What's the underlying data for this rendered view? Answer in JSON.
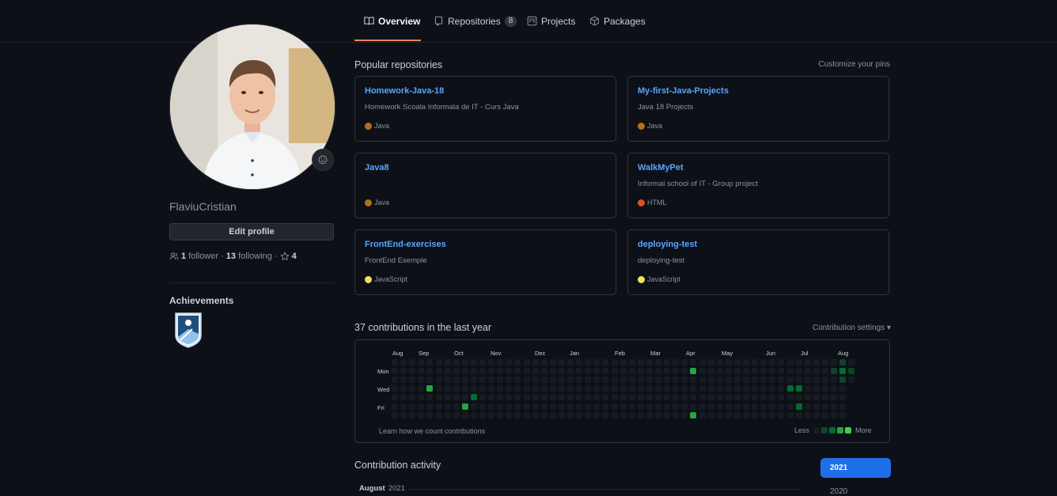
{
  "nav": {
    "tabs": [
      {
        "label": "Overview",
        "icon": "book-icon",
        "active": true
      },
      {
        "label": "Repositories",
        "icon": "repo-icon",
        "count": "8"
      },
      {
        "label": "Projects",
        "icon": "project-icon"
      },
      {
        "label": "Packages",
        "icon": "package-icon"
      }
    ]
  },
  "profile": {
    "username": "FlaviuCristian",
    "edit_label": "Edit profile",
    "followers_count": "1",
    "followers_label": "follower",
    "following_count": "13",
    "following_label": "following",
    "stars_count": "4",
    "achievements_title": "Achievements"
  },
  "pinned": {
    "title": "Popular repositories",
    "customize": "Customize your pins",
    "repos": [
      {
        "name": "Homework-Java-18",
        "desc": "Homework Scoala Informala de IT - Curs Java",
        "lang": "Java",
        "color": "#b07219"
      },
      {
        "name": "My-first-Java-Projects",
        "desc": "Java 18 Projects",
        "lang": "Java",
        "color": "#b07219"
      },
      {
        "name": "Java8",
        "desc": "",
        "lang": "Java",
        "color": "#b07219"
      },
      {
        "name": "WalkMyPet",
        "desc": "Informal school of IT - Group project",
        "lang": "HTML",
        "color": "#e34c26"
      },
      {
        "name": "FrontEnd-exercises",
        "desc": "FrontEnd Exemple",
        "lang": "JavaScript",
        "color": "#f1e05a"
      },
      {
        "name": "deploying-test",
        "desc": "deploying-test",
        "lang": "JavaScript",
        "color": "#f1e05a"
      }
    ]
  },
  "contributions": {
    "title": "37 contributions in the last year",
    "settings": "Contribution settings",
    "months": [
      "Aug",
      "Sep",
      "Oct",
      "Nov",
      "Dec",
      "Jan",
      "Feb",
      "Mar",
      "Apr",
      "May",
      "Jun",
      "Jul",
      "Aug"
    ],
    "days": [
      "Mon",
      "Wed",
      "Fri"
    ],
    "learn": "Learn how we count contributions",
    "less": "Less",
    "more": "More",
    "weeks": 53,
    "active_cells": [
      [
        4,
        3,
        3
      ],
      [
        8,
        5,
        3
      ],
      [
        9,
        4,
        2
      ],
      [
        34,
        1,
        3
      ],
      [
        34,
        6,
        3
      ],
      [
        45,
        3,
        2
      ],
      [
        46,
        3,
        2
      ],
      [
        46,
        5,
        2
      ],
      [
        50,
        1,
        1
      ],
      [
        51,
        0,
        1
      ],
      [
        51,
        1,
        2
      ],
      [
        51,
        2,
        1
      ],
      [
        52,
        1,
        1
      ]
    ],
    "colors": [
      "#161b22",
      "#0e4429",
      "#006d32",
      "#26a641",
      "#39d353"
    ]
  },
  "activity": {
    "title": "Contribution activity",
    "year_active": "2021",
    "year_other": "2020",
    "month": "August",
    "month_year": "2021"
  }
}
